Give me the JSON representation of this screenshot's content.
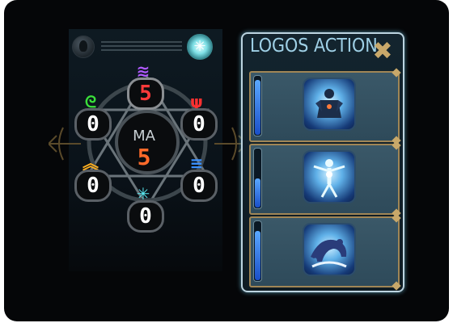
{
  "magic_panel": {
    "ma_label": "MA",
    "ma_value": "5",
    "nodes": [
      {
        "id": "top",
        "value": "5",
        "icon": "purple-wave-icon",
        "color": "#b05aff",
        "highlight": true
      },
      {
        "id": "upper-left",
        "value": "0",
        "icon": "green-swirl-icon",
        "color": "#3ae03a"
      },
      {
        "id": "upper-right",
        "value": "0",
        "icon": "red-flame-icon",
        "color": "#ff3030"
      },
      {
        "id": "lower-left",
        "value": "0",
        "icon": "orange-chevron-icon",
        "color": "#ffb020"
      },
      {
        "id": "lower-right",
        "value": "0",
        "icon": "blue-waves-icon",
        "color": "#3a90ff"
      },
      {
        "id": "bottom",
        "value": "0",
        "icon": "cyan-star-icon",
        "color": "#5ae8f0"
      }
    ]
  },
  "logos_panel": {
    "title": "LOGOS ACTION",
    "actions": [
      {
        "icon": "armored-warrior-icon",
        "gauge_fill": 0.95
      },
      {
        "icon": "glowing-figure-icon",
        "gauge_fill": 0.5
      },
      {
        "icon": "crouching-beast-icon",
        "gauge_fill": 0.85
      }
    ]
  },
  "colors": {
    "background": "#050608",
    "panel_border": "#bcd4e0",
    "slot_border": "#a08656",
    "title": "#9fd0e6",
    "ma_value": "#ff6a2a"
  }
}
